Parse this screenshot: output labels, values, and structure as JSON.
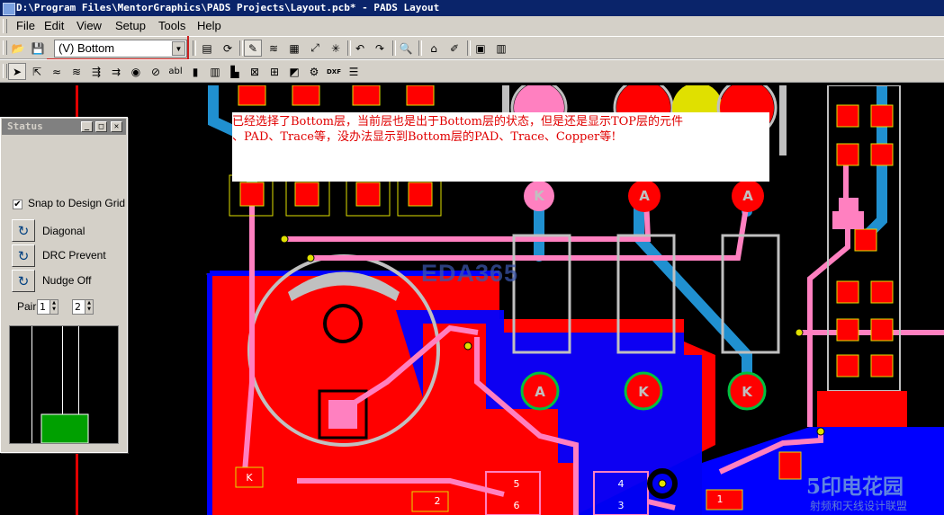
{
  "window": {
    "title": "D:\\Program Files\\MentorGraphics\\PADS Projects\\Layout.pcb* - PADS Layout"
  },
  "menu": {
    "items": [
      "File",
      "Edit",
      "View",
      "Setup",
      "Tools",
      "Help"
    ]
  },
  "toolbar": {
    "layer_select": "(V) Bottom",
    "dxf_label": "DXF"
  },
  "status_window": {
    "title": "Status",
    "snap_to_design_grid": {
      "label": "Snap to Design Grid",
      "checked": true
    },
    "diagonal_label": "Diagonal",
    "drc_label": "DRC Prevent",
    "nudge_label": "Nudge Off",
    "pair_label": "Pair:",
    "pair_value_1": "1",
    "pair_value_2": "2"
  },
  "annotation": {
    "line1": "已经选择了Bottom层，当前层也是出于Bottom层的状态，但是还是显示TOP层的元件",
    "line2": "、PAD、Trace等，没办法显示到Bottom层的PAD、Trace、Copper等!"
  },
  "pcb_labels": {
    "pad_top": [
      "K",
      "A",
      "A"
    ],
    "pad_bottom": [
      "A",
      "K",
      "K"
    ],
    "pad_k": "K",
    "pin_numbers": [
      "5",
      "6",
      "4",
      "3",
      "1",
      "2"
    ]
  },
  "watermark": {
    "text": "EDA365",
    "logo_big": "5印电花园",
    "logo_small": "射频和天线设计联盟"
  },
  "colors": {
    "titlebar": "#0a246a",
    "copper": "#ff0000",
    "bottom_plane": "#0000ff",
    "trace_pink": "#ff80c0",
    "trace_blue": "#2090d0",
    "silkscreen": "#c0c0c0"
  }
}
